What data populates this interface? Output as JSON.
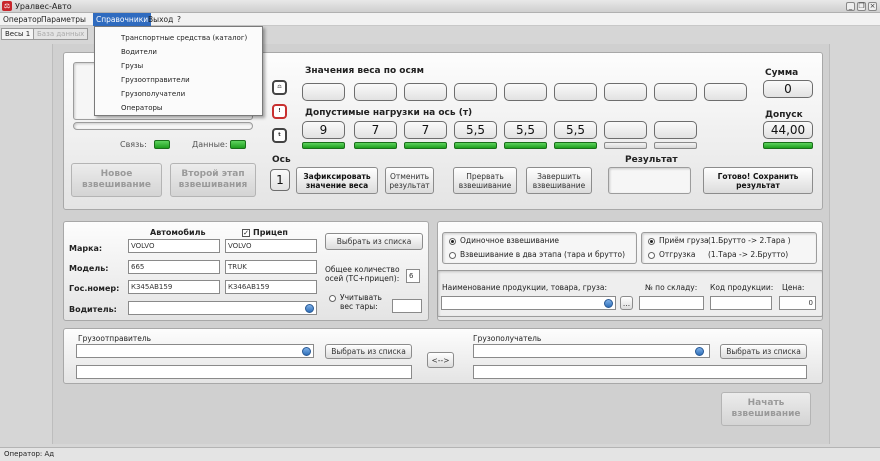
{
  "window": {
    "title": "Уралвес-Авто",
    "icon": "app-scale-icon"
  },
  "menu": [
    "Оператор",
    "Параметры",
    "Справочники",
    "Выход",
    "?"
  ],
  "tabs": [
    "Весы 1",
    "База данных"
  ],
  "dropdown": [
    "Транспортные средства (каталог)",
    "Водители",
    "Грузы",
    "Грузоотправители",
    "Грузополучатели",
    "Операторы"
  ],
  "weigh": {
    "axle_weights_title": "Значения веса по осям",
    "sum_label": "Сумма",
    "sum_value": "0",
    "limits_title": "Допустимые нагрузки на ось (т)",
    "tolerance_label": "Допуск",
    "tolerance_value": "44,00",
    "limits": [
      "9",
      "7",
      "7",
      "5,5",
      "5,5",
      "5,5",
      "",
      ""
    ],
    "axle_label": "Ось",
    "axle_value": "1",
    "result_label": "Результат",
    "connection_label": "Связь:",
    "data_label": "Данные:",
    "connection_status": "on",
    "data_status": "on",
    "axle_indicators": [
      "on",
      "on",
      "on",
      "on",
      "on",
      "on",
      "off",
      "off"
    ],
    "sum_indicator": "on"
  },
  "buttons": {
    "new_weighing": "Новое взвешивание",
    "second_stage": "Второй этап взвешивания",
    "fix_weight": "Зафиксировать значение веса",
    "cancel_result": "Отменить результат",
    "abort_weighing": "Прервать взвешивание",
    "finish_weighing": "Завершить взвешивание",
    "done_save": "Готово! Сохранить результат",
    "start_weighing": "Начать взвешивание",
    "choose_from_list": "Выбрать из списка",
    "swap": "<-->",
    "ellipsis": "..."
  },
  "vehicle": {
    "car_header": "Автомобиль",
    "trailer_header": "Прицеп",
    "trailer_checked": true,
    "brand_label": "Марка:",
    "model_label": "Модель:",
    "plate_label": "Гос.номер:",
    "driver_label": "Водитель:",
    "brand": [
      "VOLVO",
      "VOLVO"
    ],
    "model": [
      "665",
      "TRUK"
    ],
    "plate": [
      "К345АВ159",
      "К346АВ159"
    ],
    "axles_total_label": "Общее количество осей (ТС+прицеп):",
    "axles_total": "6",
    "tare_label": "Учитывать вес тары:"
  },
  "mode": {
    "single": "Одиночное взвешивание",
    "two_stage": "Взвешивание в два этапа (тара и брутто)",
    "receive": "Приём груза",
    "receive_hint": "(1.Брутто -> 2.Тара )",
    "ship": "Отгрузка",
    "ship_hint": "(1.Тара -> 2.Брутто)",
    "mode_selected": "single",
    "direction_selected": "receive"
  },
  "product": {
    "name_label": "Наименование продукции, товара, груза:",
    "warehouse_label": "№ по складу:",
    "code_label": "Код продукции:",
    "price_label": "Цена:",
    "price_value": "0"
  },
  "parties": {
    "sender_label": "Грузоотправитель",
    "receiver_label": "Грузополучатель"
  },
  "status": {
    "operator": "Оператор: Ад"
  }
}
